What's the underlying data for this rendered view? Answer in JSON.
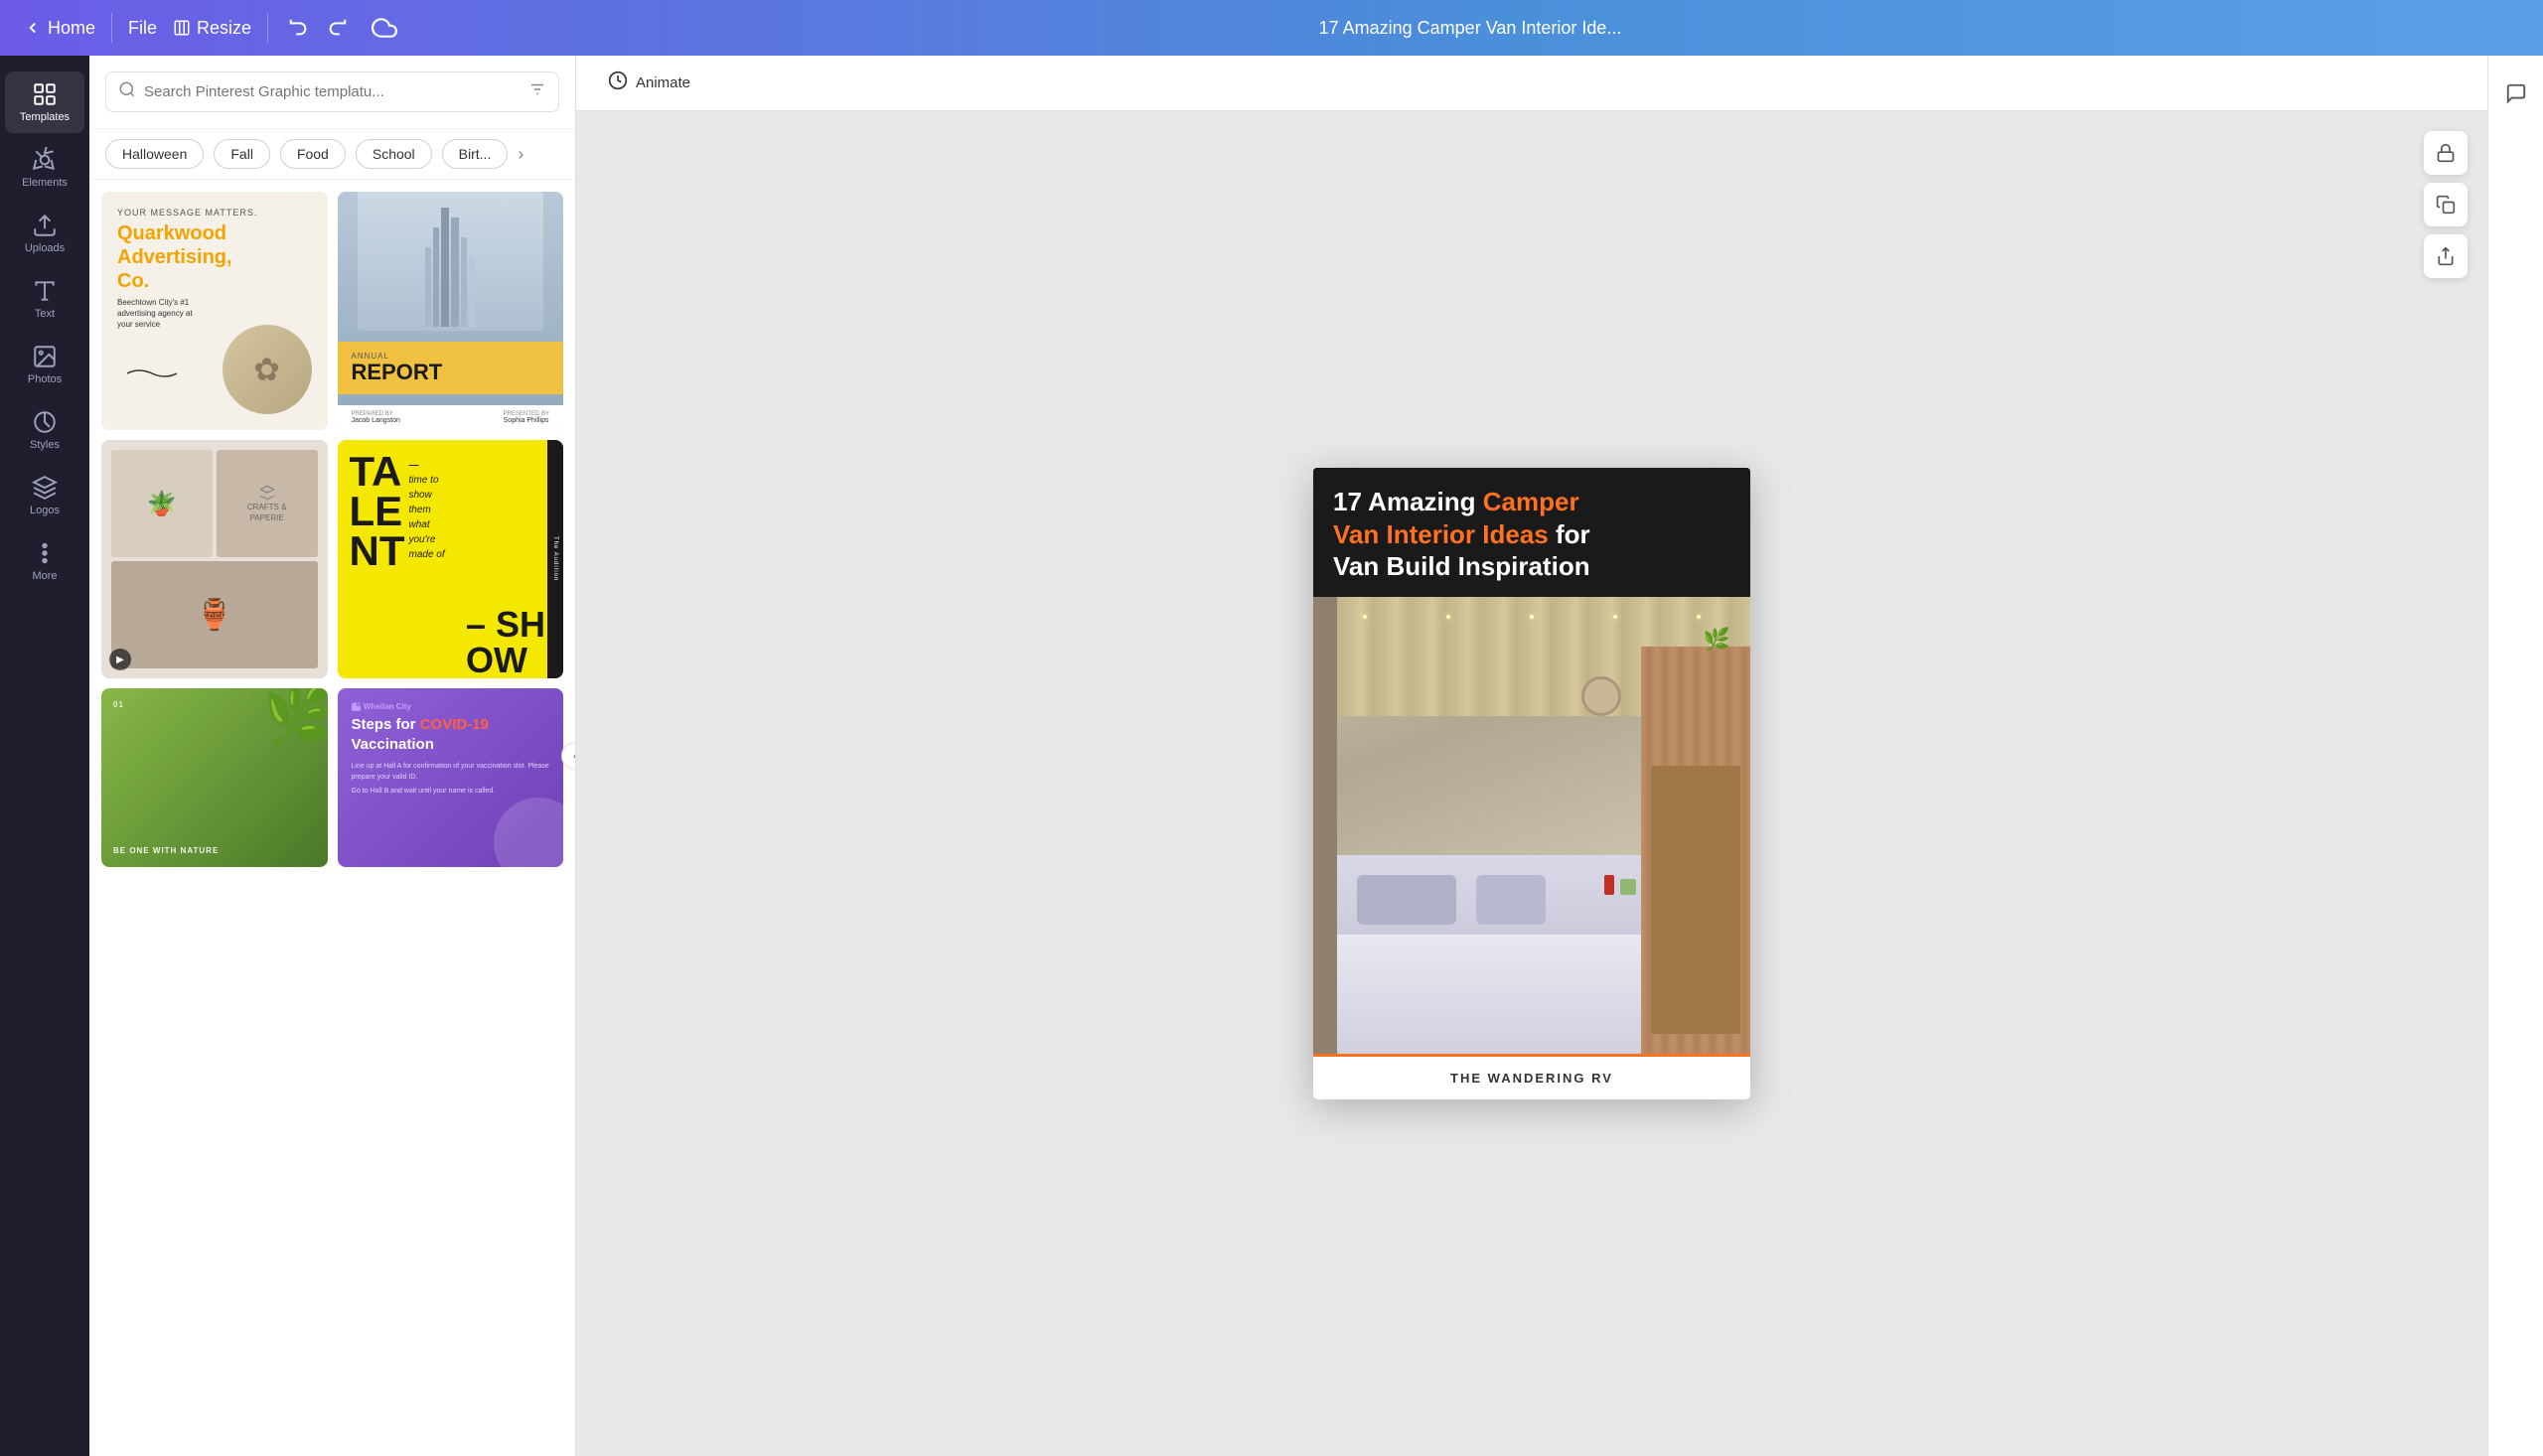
{
  "topbar": {
    "home_label": "Home",
    "file_label": "File",
    "resize_label": "Resize",
    "title": "17 Amazing Camper Van Interior Ide...",
    "cloud_status": "saved"
  },
  "sidebar": {
    "items": [
      {
        "id": "templates",
        "label": "Templates",
        "icon": "grid-icon"
      },
      {
        "id": "elements",
        "label": "Elements",
        "icon": "shapes-icon"
      },
      {
        "id": "uploads",
        "label": "Uploads",
        "icon": "upload-icon"
      },
      {
        "id": "text",
        "label": "Text",
        "icon": "text-icon"
      },
      {
        "id": "photos",
        "label": "Photos",
        "icon": "photo-icon"
      },
      {
        "id": "styles",
        "label": "Styles",
        "icon": "styles-icon"
      },
      {
        "id": "logos",
        "label": "Logos",
        "icon": "logos-icon"
      },
      {
        "id": "more",
        "label": "More",
        "icon": "more-icon"
      }
    ]
  },
  "panel": {
    "search_placeholder": "Search Pinterest Graphic templatu...",
    "filter_tags": [
      {
        "label": "Halloween",
        "active": false
      },
      {
        "label": "Fall",
        "active": false
      },
      {
        "label": "Food",
        "active": false
      },
      {
        "label": "School",
        "active": false
      },
      {
        "label": "Birt...",
        "active": false
      }
    ],
    "templates": [
      {
        "id": "quarkwood",
        "type": "quarkwood",
        "tag": "YOUR MESSAGE MATTERS.",
        "title": "Quarkwood Advertising, Co.",
        "subtitle": "Beechtown City's #1 advertising agency at your service"
      },
      {
        "id": "annual-report",
        "type": "annual",
        "label": "ANNUAL REPORT",
        "prepared_by": "PREPARED BY",
        "presented_by": "PRESENTED BY",
        "preparer": "Jacob Langston",
        "presenter": "Sophia Phillips"
      },
      {
        "id": "crafts",
        "type": "crafts",
        "brand": "CRAFTS & PAPERIE",
        "has_video": true
      },
      {
        "id": "talent",
        "type": "talent",
        "big_text": "TA LE NT",
        "text": "time to show them what you're made of",
        "dash": "–",
        "show": "SH OW"
      },
      {
        "id": "nature",
        "type": "nature",
        "number": "01",
        "text": "BE ONE WITH NATURE"
      },
      {
        "id": "covid",
        "type": "covid",
        "badge": "Wheilan City",
        "title_start": "Steps for ",
        "title_highlight": "COVID-19",
        "title_end": " Vaccination",
        "items": [
          "Line up at Hall A for confirmation of your vaccination slot. Please prepare your valid ID.",
          "Go to Hall B and wait until your name is called."
        ]
      }
    ]
  },
  "canvas": {
    "animate_label": "Animate",
    "design": {
      "title_line1_normal": "17 Amazing ",
      "title_line1_highlight": "Camper",
      "title_line2_highlight": "Van Interior Ideas",
      "title_line2_normal": " for",
      "title_line3": "Van Build Inspiration",
      "footer_brand": "THE WANDERING RV"
    }
  },
  "canvas_controls": {
    "lock_label": "lock",
    "copy_label": "copy",
    "share_label": "share"
  }
}
